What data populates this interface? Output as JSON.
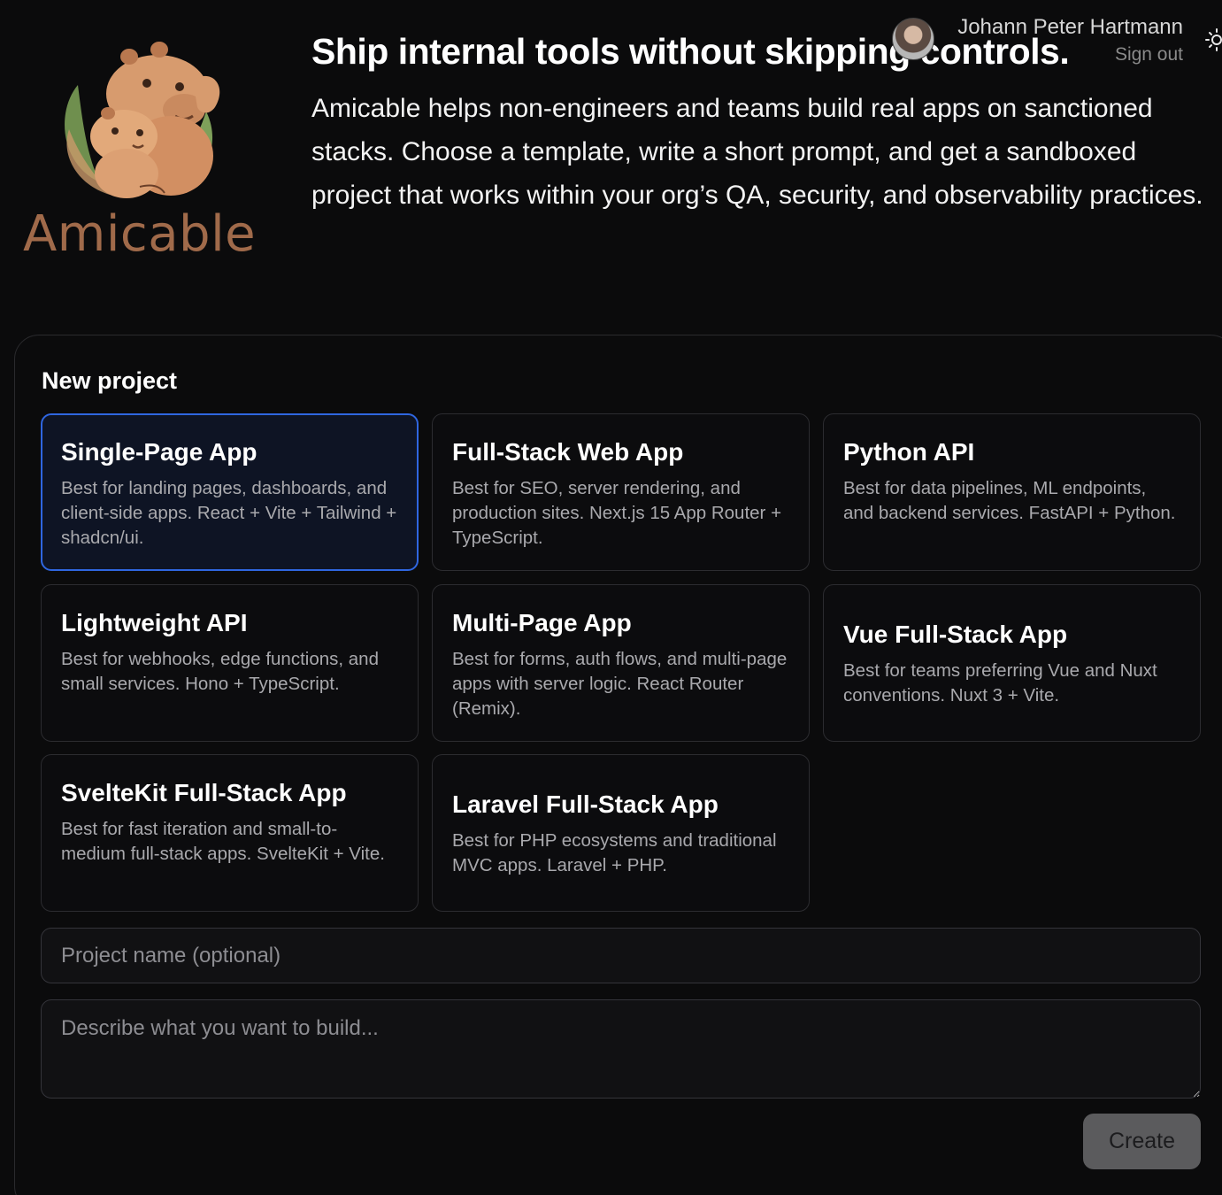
{
  "brand": {
    "name": "Amicable",
    "text_color": "#a06a4a"
  },
  "user": {
    "name": "Johann Peter Hartmann",
    "sign_out_label": "Sign out"
  },
  "hero": {
    "title": "Ship internal tools without skipping controls.",
    "description": "Amicable helps non-engineers and teams build real apps on sanctioned stacks. Choose a template, write a short prompt, and get a sandboxed project that works within your org’s QA, security, and observability practices."
  },
  "new_project": {
    "title": "New project",
    "selected_color": "#2f66e0",
    "templates": [
      {
        "title": "Single-Page App",
        "description": "Best for landing pages, dashboards, and client-side apps. React + Vite + Tailwind + shadcn/ui.",
        "selected": true
      },
      {
        "title": "Full-Stack Web App",
        "description": "Best for SEO, server rendering, and production sites. Next.js 15 App Router + TypeScript.",
        "selected": false
      },
      {
        "title": "Python API",
        "description": "Best for data pipelines, ML endpoints, and backend services. FastAPI + Python.",
        "selected": false
      },
      {
        "title": "Lightweight API",
        "description": "Best for webhooks, edge functions, and small services. Hono + TypeScript.",
        "selected": false
      },
      {
        "title": "Multi-Page App",
        "description": "Best for forms, auth flows, and multi-page apps with server logic. React Router (Remix).",
        "selected": false
      },
      {
        "title": "Vue Full-Stack App",
        "description": "Best for teams preferring Vue and Nuxt conventions. Nuxt 3 + Vite.",
        "selected": false
      },
      {
        "title": "SvelteKit Full-Stack App",
        "description": "Best for fast iteration and small-to-medium full-stack apps. SvelteKit + Vite.",
        "selected": false
      },
      {
        "title": "Laravel Full-Stack App",
        "description": "Best for PHP ecosystems and traditional MVC apps. Laravel + PHP.",
        "selected": false
      }
    ],
    "name_placeholder": "Project name (optional)",
    "prompt_placeholder": "Describe what you want to build...",
    "create_label": "Create"
  }
}
